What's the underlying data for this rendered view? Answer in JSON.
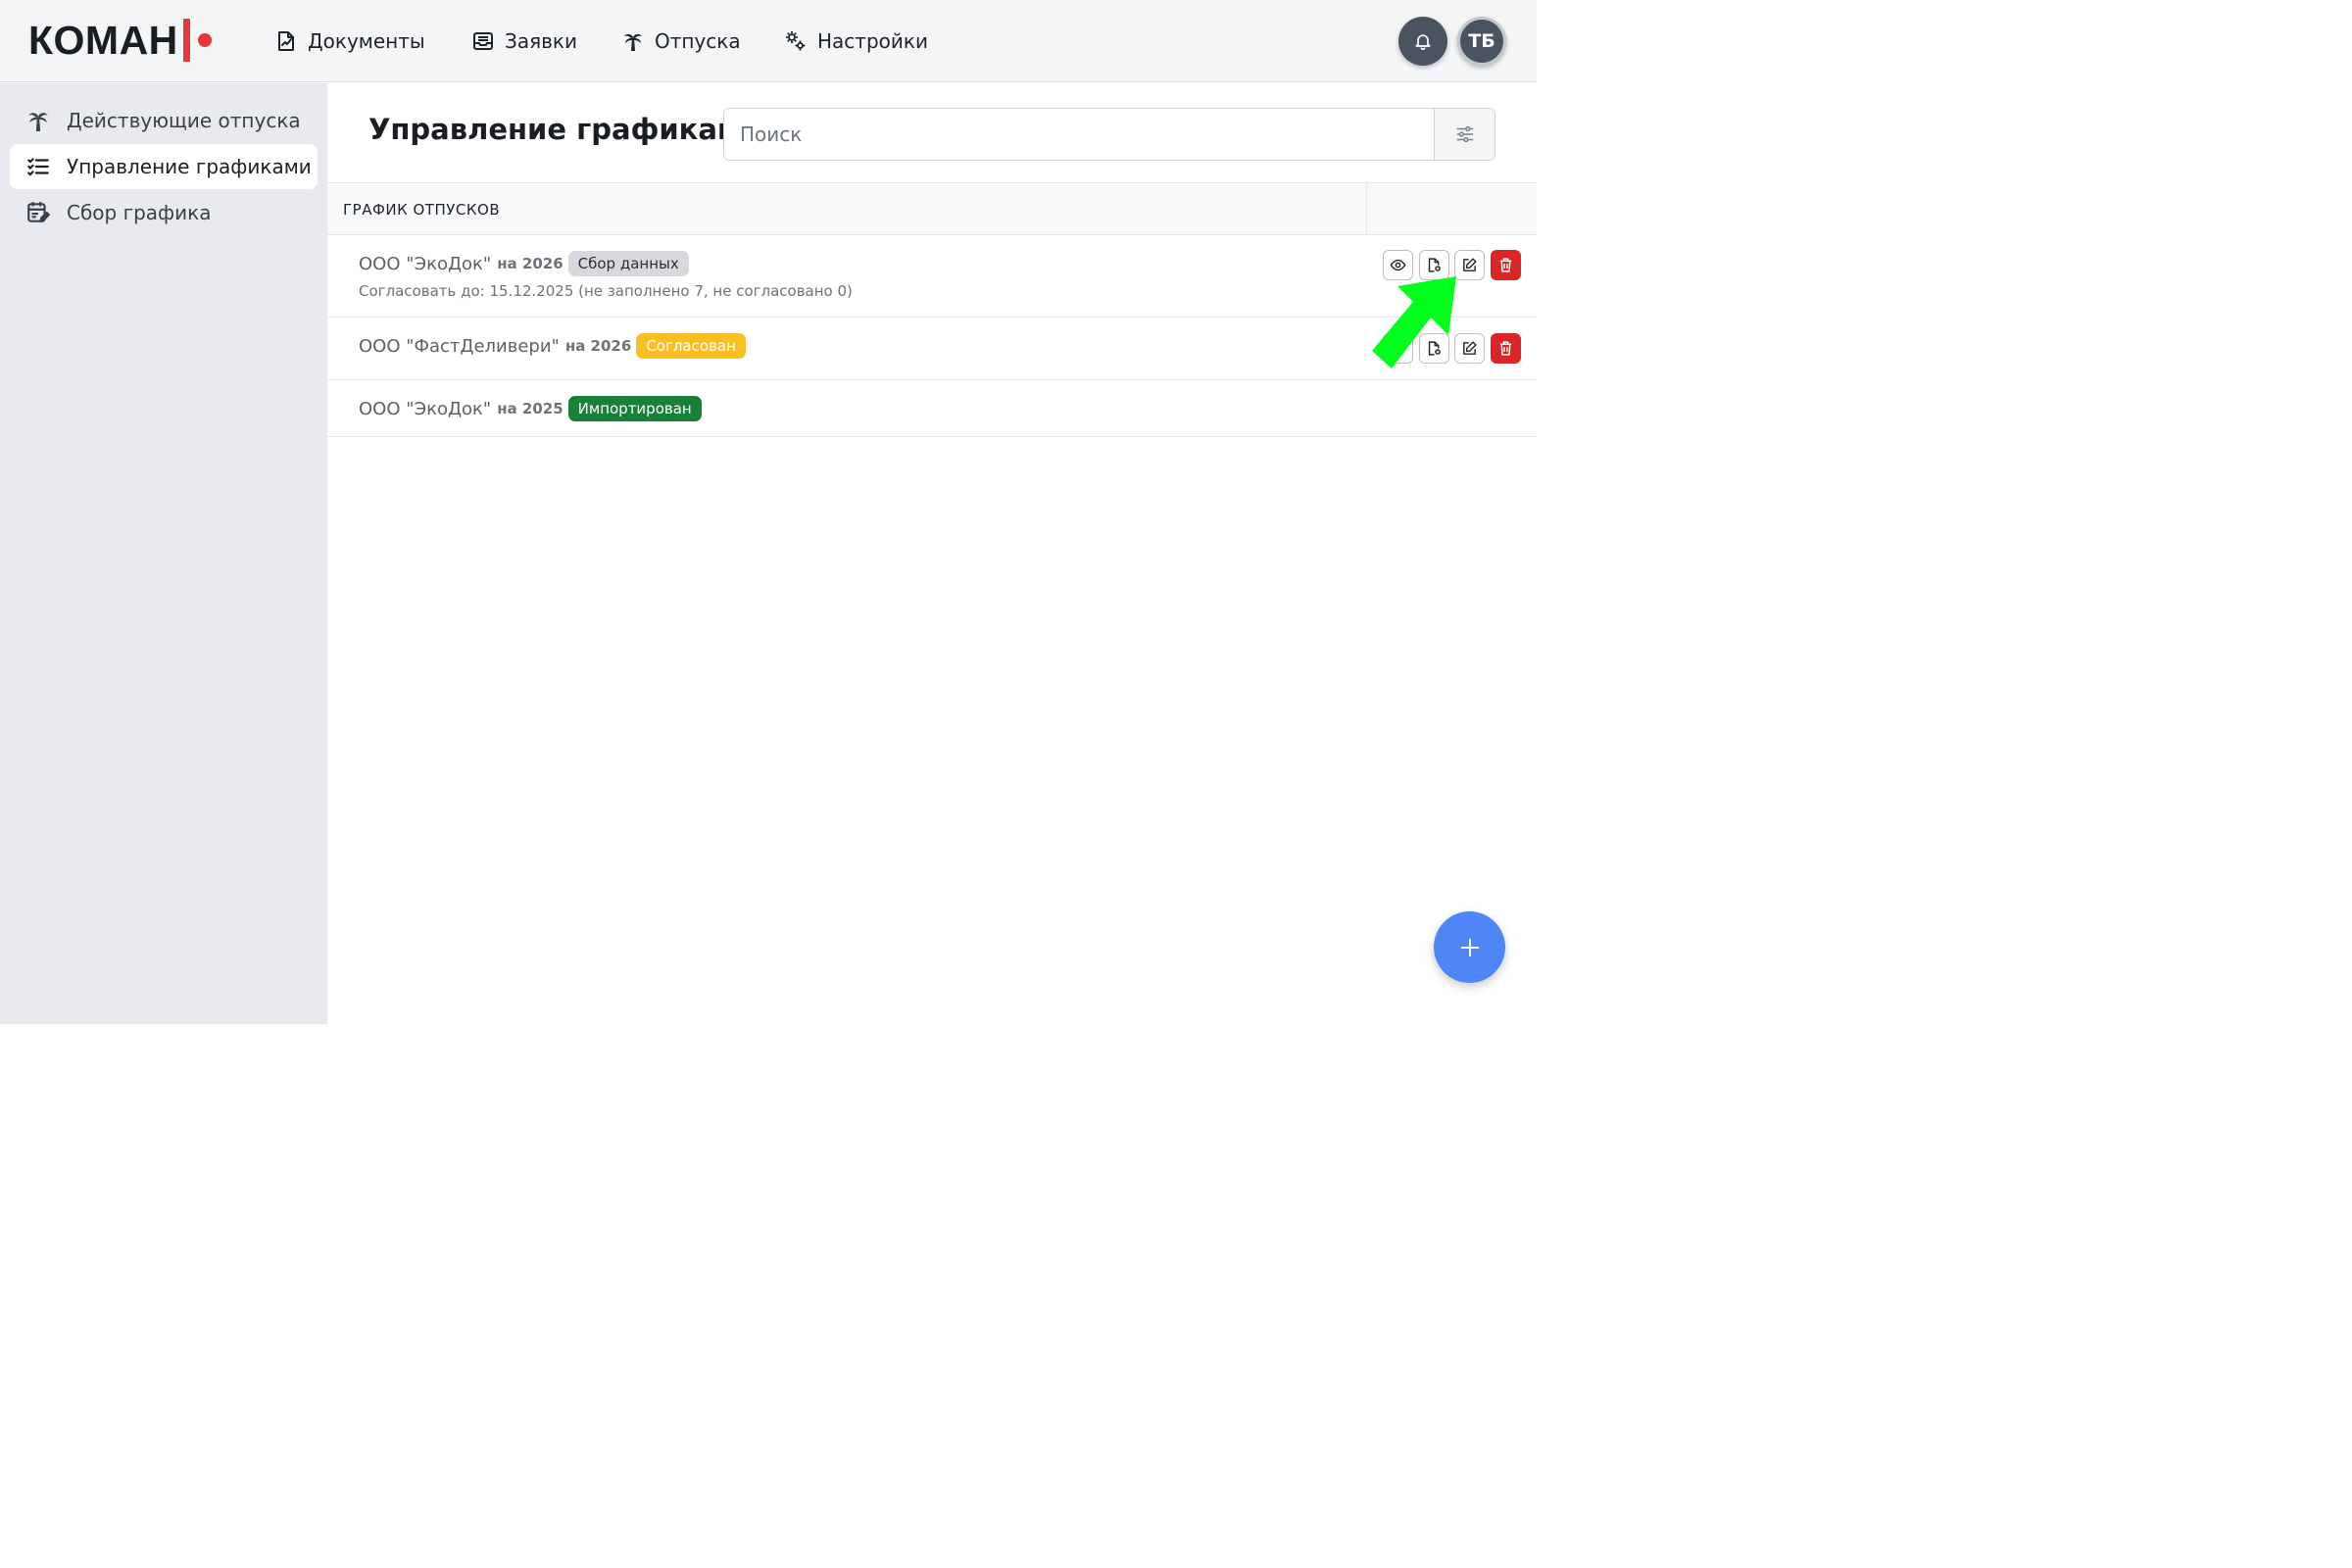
{
  "header": {
    "logo_text": "КОМАН",
    "nav": [
      {
        "label": "Документы",
        "icon": "document-chart-icon"
      },
      {
        "label": "Заявки",
        "icon": "inbox-icon"
      },
      {
        "label": "Отпуска",
        "icon": "palm-tree-icon"
      },
      {
        "label": "Настройки",
        "icon": "gears-icon"
      }
    ],
    "user_initials": "ТБ"
  },
  "sidebar": {
    "items": [
      {
        "label": "Действующие отпуска",
        "icon": "palm-tree-icon",
        "active": false
      },
      {
        "label": "Управление графиками",
        "icon": "checklist-icon",
        "active": true
      },
      {
        "label": "Сбор графика",
        "icon": "calendar-edit-icon",
        "active": false
      }
    ]
  },
  "main": {
    "title": "Управление графиками",
    "search": {
      "placeholder": "Поиск",
      "value": ""
    },
    "table": {
      "header": "ГРАФИК ОТПУСКОВ",
      "rows": [
        {
          "company": "ООО \"ЭкоДок\"",
          "year": "на 2026",
          "status": "Сбор данных",
          "status_color": "#d7d9dd",
          "subtitle": "Согласовать до: 15.12.2025 (не заполнено 7, не согласовано 0)"
        },
        {
          "company": "ООО \"ФастДеливери\"",
          "year": "на 2026",
          "status": "Согласован",
          "status_color": "#fbbf24"
        },
        {
          "company": "ООО \"ЭкоДок\"",
          "year": "на 2025",
          "status": "Импортирован",
          "status_color": "#198038"
        }
      ]
    }
  },
  "colors": {
    "accent_red": "#e8363d",
    "fab_blue": "#4f86f7",
    "delete_red": "#dc2626",
    "highlight_arrow": "#00ff1a"
  }
}
